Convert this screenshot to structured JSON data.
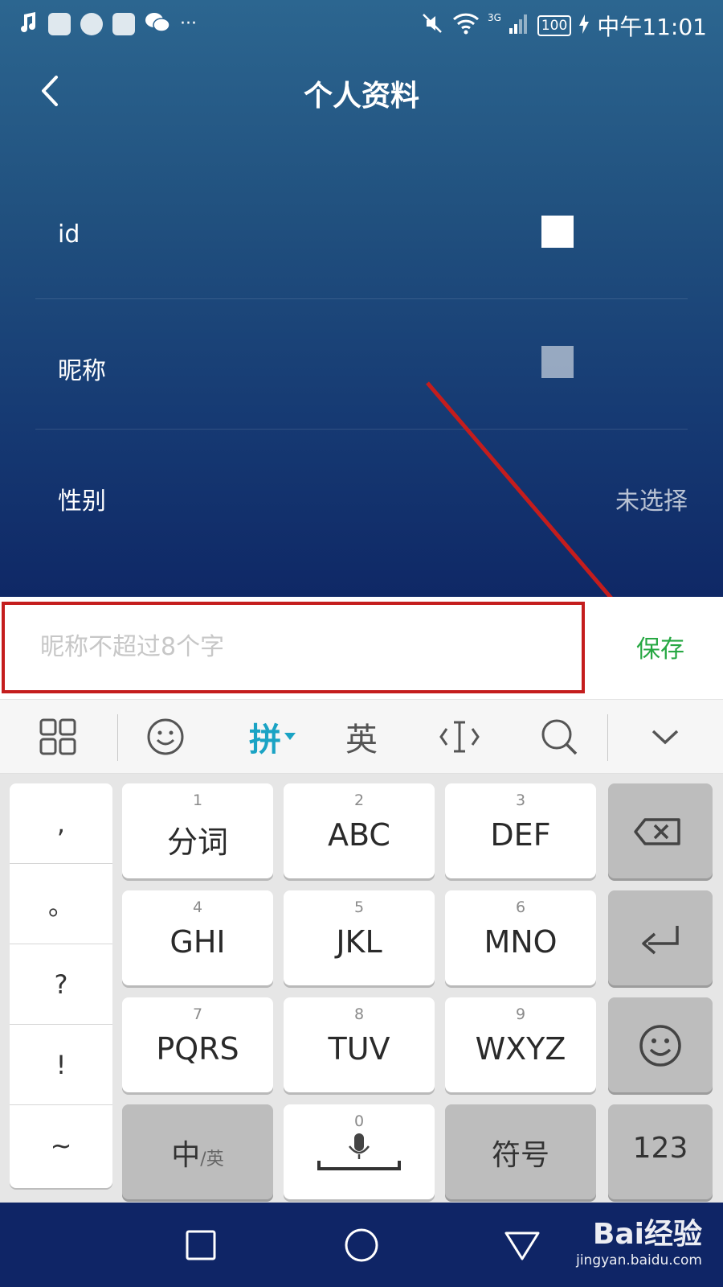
{
  "status_bar": {
    "signal": "3G",
    "battery": "100",
    "time": "中午11:01",
    "more": "···"
  },
  "header": {
    "title": "个人资料"
  },
  "profile": {
    "rows": [
      {
        "label": "id",
        "value": ""
      },
      {
        "label": "昵称",
        "value": ""
      },
      {
        "label": "性别",
        "value": "未选择"
      }
    ]
  },
  "nickname_input": {
    "placeholder": "昵称不超过8个字",
    "value": ""
  },
  "save_label": "保存",
  "keyboard_toolbar": {
    "pinyin": "拼",
    "english": "英"
  },
  "keyboard": {
    "punctuation": [
      ",",
      "。",
      "?",
      "!",
      "~"
    ],
    "keys": [
      {
        "num": "1",
        "label": "分词"
      },
      {
        "num": "2",
        "label": "ABC"
      },
      {
        "num": "3",
        "label": "DEF"
      },
      {
        "num": "4",
        "label": "GHI"
      },
      {
        "num": "5",
        "label": "JKL"
      },
      {
        "num": "6",
        "label": "MNO"
      },
      {
        "num": "7",
        "label": "PQRS"
      },
      {
        "num": "8",
        "label": "TUV"
      },
      {
        "num": "9",
        "label": "WXYZ"
      }
    ],
    "bottom": {
      "zh_main": "中",
      "zh_sub": "/英",
      "space_num": "0",
      "symbols": "符号",
      "numbers": "123"
    }
  },
  "watermark": {
    "brand": "Bai经验",
    "url": "jingyan.baidu.com"
  },
  "colors": {
    "accent_green": "#27a843",
    "highlight_red": "#c41d1d",
    "pinyin_active": "#1aa3c4"
  }
}
